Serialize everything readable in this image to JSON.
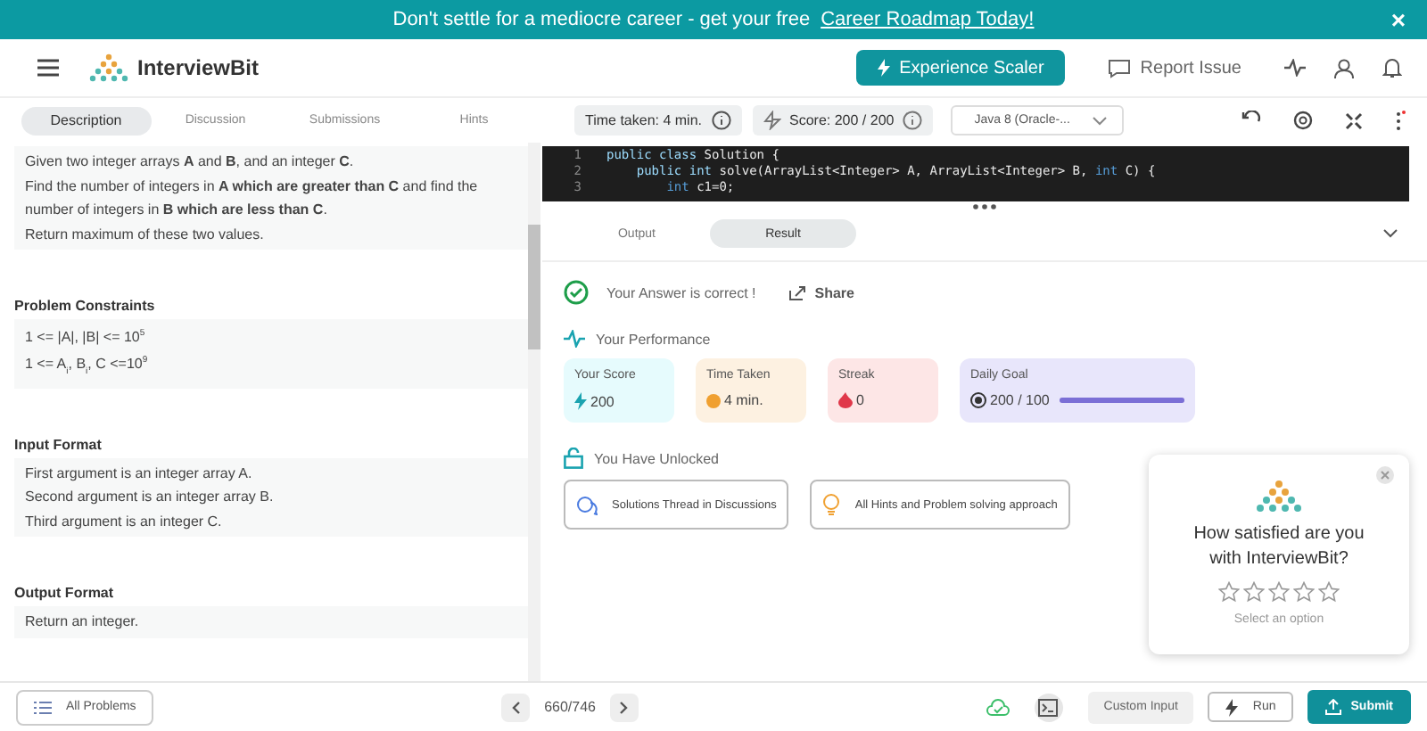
{
  "banner": {
    "text": "Don't settle for a mediocre career - get your free",
    "link": "Career Roadmap Today!",
    "close": "×"
  },
  "header": {
    "logo": "InterviewBit",
    "cta": "Experience Scaler",
    "report": "Report Issue"
  },
  "tabs": [
    {
      "label": "Description",
      "selected": true
    },
    {
      "label": "Discussion",
      "selected": false
    },
    {
      "label": "Submissions",
      "selected": false
    },
    {
      "label": "Hints",
      "selected": false
    }
  ],
  "toolbar": {
    "time_taken": "Time taken: 4 min.",
    "score": "Score: 200 / 200",
    "language": "Java 8 (Oracle-..."
  },
  "statement": [
    "Given two integer arrays **A** and **B**, and an integer **C**.",
    "Find the number of integers in **A which are greater than C** and find the number of integers in **B which are less than C**.",
    "Return maximum of these two values."
  ],
  "sections": [
    {
      "title": "Problem Constraints",
      "lines": [
        "1 <= |A|, |B| <= 10$^{5}$",
        "1 <= A$_{i}$, B$_{i}$, C <=10$^{9}$"
      ]
    },
    {
      "title": "Input Format",
      "lines": [
        "First argument is an integer array A.",
        "Second argument is an integer array B.",
        "Third argument is an integer C."
      ]
    },
    {
      "title": "Output Format",
      "lines": [
        "Return an integer."
      ]
    }
  ],
  "code": [
    {
      "number": "1",
      "tokens": [
        {
          "kind": "keyword",
          "text": "public class"
        },
        {
          "kind": "plain",
          "text": " Solution {"
        }
      ]
    },
    {
      "number": "2",
      "tokens": [
        {
          "kind": "keyword",
          "text": "    public int"
        },
        {
          "kind": "plain",
          "text": " solve(ArrayList<Integer> A, ArrayList<Integer> B, "
        },
        {
          "kind": "type",
          "text": "int"
        },
        {
          "kind": "plain",
          "text": " C) {"
        }
      ]
    },
    {
      "number": "3",
      "tokens": [
        {
          "kind": "type",
          "text": "        int"
        },
        {
          "kind": "plain",
          "text": " c1=0;"
        }
      ]
    }
  ],
  "result_tabs": [
    {
      "label": "Output",
      "selected": false
    },
    {
      "label": "Result",
      "selected": true
    }
  ],
  "result": {
    "message": "Your Answer is correct !",
    "share": "Share",
    "performance_title": "Your Performance",
    "stats": [
      {
        "kind": "score",
        "label": "Your Score",
        "value": "200"
      },
      {
        "kind": "time",
        "label": "Time Taken",
        "value": "4 min."
      },
      {
        "kind": "streak",
        "label": "Streak",
        "value": "0"
      },
      {
        "kind": "goal",
        "label": "Daily Goal",
        "value": "200 / 100",
        "level": 1
      }
    ],
    "unlocked_title": "You Have Unlocked",
    "unlocks": [
      {
        "kind": "discussion",
        "label": "Solutions Thread in Discussions"
      },
      {
        "kind": "hint",
        "label": "All Hints and Problem solving approach"
      }
    ]
  },
  "feedback": {
    "question": "How satisfied are you with InterviewBit?",
    "stars": 0,
    "hint": "Select an option"
  },
  "footer": {
    "all_problems": "All Problems",
    "counter": "660/746",
    "custom_input": "Custom Input",
    "run": "Run",
    "submit": "Submit"
  }
}
